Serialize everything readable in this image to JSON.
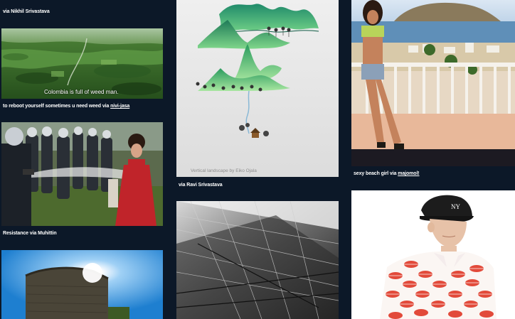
{
  "pins": [
    {
      "id": "colombia",
      "image_text": "Colombia is full of weed man.",
      "caption_prefix": "to reboot yourself sometimes u need weed via ",
      "caption_link": "nivi-jasa"
    },
    {
      "id": "protest",
      "caption_prefix": "Resistance via Muhittin",
      "caption_link": ""
    },
    {
      "id": "landscape",
      "credit": "Vertical landscape by Eiko Ojala",
      "caption_prefix": "via Ravi Srivastava",
      "caption_link": ""
    },
    {
      "id": "beach",
      "caption_prefix": "sexy beach girl via ",
      "caption_link": "majomol!"
    }
  ],
  "top_caption": "via Nikhil Srivastava",
  "colors": {
    "background": "#0c1828",
    "caption": "#ffffff"
  }
}
